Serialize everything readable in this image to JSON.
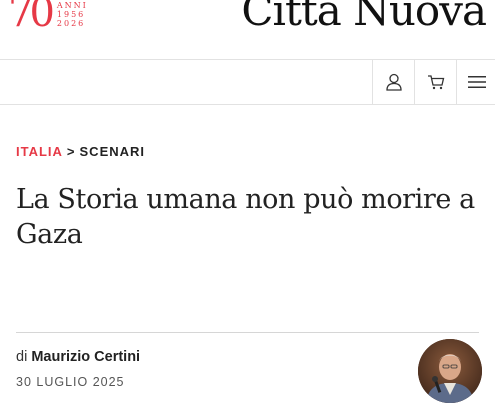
{
  "header": {
    "anniversary": {
      "number": "70",
      "lines": [
        "ANNI",
        "1956",
        "2026"
      ]
    },
    "brand": "Città Nuova"
  },
  "toolbar": {
    "user_icon": "user-icon",
    "cart_icon": "cart-icon",
    "menu_icon": "hamburger-menu-icon"
  },
  "article": {
    "breadcrumb": {
      "country": "ITALIA",
      "separator": ">",
      "section": "SCENARI"
    },
    "title": "La Storia umana non può morire a Gaza",
    "byline_prefix": "di",
    "author": "Maurizio Certini",
    "date": "30 LUGLIO 2025"
  },
  "colors": {
    "accent": "#e63946",
    "text": "#222222",
    "border": "#e2e2e2"
  }
}
